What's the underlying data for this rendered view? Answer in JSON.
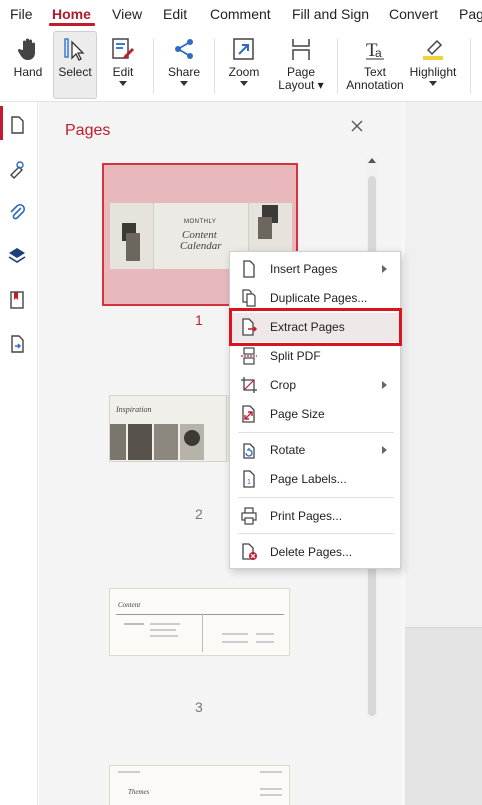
{
  "menubar": {
    "items": [
      "File",
      "Home",
      "View",
      "Edit",
      "Comment",
      "Fill and Sign",
      "Convert",
      "Page"
    ],
    "active": "Home"
  },
  "ribbon": {
    "hand": "Hand",
    "select": "Select",
    "edit": "Edit",
    "share": "Share",
    "zoom": "Zoom",
    "page_layout": [
      "Page",
      "Layout"
    ],
    "text_annotation": [
      "Text",
      "Annotation"
    ],
    "highlight": "Highlight"
  },
  "rail": {
    "icons": [
      "page-thumbnails-icon",
      "signature-icon",
      "attachment-icon",
      "layers-icon",
      "bookmark-icon",
      "export-icon"
    ]
  },
  "panel": {
    "title": "Pages",
    "pages": [
      {
        "number": "1",
        "thumb": {
          "header": "MONTHLY",
          "title_line1": "Content",
          "title_line2": "Calendar"
        }
      },
      {
        "number": "2",
        "thumb": {
          "title": "Inspiration"
        }
      },
      {
        "number": "3",
        "thumb": {
          "title": "Content"
        }
      },
      {
        "number": "",
        "thumb": {
          "title": "Themes"
        }
      }
    ]
  },
  "context_menu": {
    "items": [
      {
        "label": "Insert Pages",
        "icon": "insert-pages-icon",
        "submenu": true
      },
      {
        "label": "Duplicate Pages...",
        "icon": "duplicate-pages-icon",
        "submenu": false
      },
      {
        "label": "Extract Pages",
        "icon": "extract-pages-icon",
        "submenu": false,
        "highlighted": true
      },
      {
        "label": "Split PDF",
        "icon": "split-pdf-icon",
        "submenu": false
      },
      {
        "label": "Crop",
        "icon": "crop-icon",
        "submenu": true
      },
      {
        "label": "Page Size",
        "icon": "page-size-icon",
        "submenu": false
      },
      {
        "label": "Rotate",
        "icon": "rotate-icon",
        "submenu": true
      },
      {
        "label": "Page Labels...",
        "icon": "page-labels-icon",
        "submenu": false
      },
      {
        "label": "Print Pages...",
        "icon": "print-pages-icon",
        "submenu": false
      },
      {
        "label": "Delete Pages...",
        "icon": "delete-pages-icon",
        "submenu": false
      }
    ]
  },
  "colors": {
    "accent": "#c21b2d",
    "selection_fill": "#e8b8bc",
    "highlight_outline": "#d9141f"
  }
}
